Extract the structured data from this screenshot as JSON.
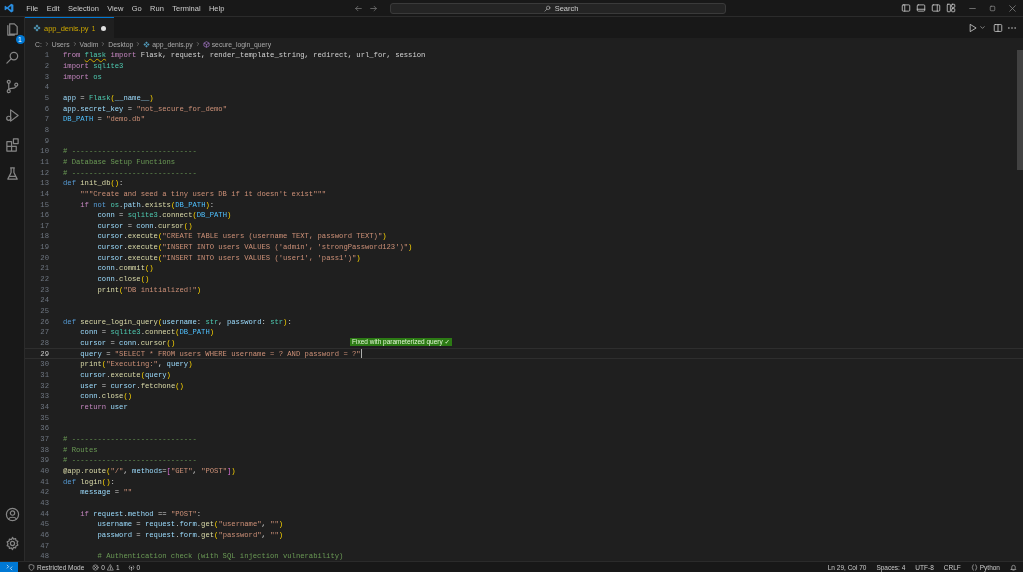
{
  "title_bar": {
    "menus": [
      "File",
      "Edit",
      "Selection",
      "View",
      "Go",
      "Run",
      "Terminal",
      "Help"
    ],
    "search": {
      "placeholder": "Search"
    }
  },
  "activity_bar": {
    "top": [
      {
        "kind": "explorer",
        "badge": "1",
        "selected": false
      },
      {
        "kind": "search",
        "selected": false
      },
      {
        "kind": "source-control",
        "selected": false
      },
      {
        "kind": "run",
        "selected": false
      },
      {
        "kind": "extensions",
        "selected": false
      },
      {
        "kind": "testing",
        "selected": false
      }
    ],
    "bottom": [
      {
        "kind": "account"
      },
      {
        "kind": "settings"
      }
    ]
  },
  "tabs": [
    {
      "label": "app_denis.py",
      "problems": "1",
      "modified": true,
      "selected": true
    }
  ],
  "breadcrumbs": [
    {
      "kind": "folder",
      "text": "C:"
    },
    {
      "kind": "folder",
      "text": "Users"
    },
    {
      "kind": "folder",
      "text": "Vadim"
    },
    {
      "kind": "folder",
      "text": "Desktop"
    },
    {
      "kind": "file",
      "text": "app_denis.py"
    },
    {
      "kind": "symbol",
      "text": "secure_login_query"
    }
  ],
  "editor": {
    "lines": [
      {
        "number": "1",
        "current": false,
        "tokens": [
          {
            "kind": "keyword",
            "text": "from "
          },
          {
            "kind": "module",
            "text": "flask",
            "warning": true
          },
          {
            "kind": "keyword",
            "text": " import"
          },
          {
            "kind": "plain",
            "text": " Flask, request, render_template_string, redirect, url_for, session"
          }
        ]
      },
      {
        "number": "2",
        "current": false,
        "tokens": [
          {
            "kind": "keyword",
            "text": "import"
          },
          {
            "kind": "module",
            "text": " sqlite3"
          }
        ]
      },
      {
        "number": "3",
        "current": false,
        "tokens": [
          {
            "kind": "keyword",
            "text": "import"
          },
          {
            "kind": "module",
            "text": " os"
          }
        ]
      },
      {
        "number": "4",
        "current": false
      },
      {
        "number": "5",
        "current": false,
        "tokens": [
          {
            "kind": "variable",
            "text": "app"
          },
          {
            "kind": "plain",
            "text": " = "
          },
          {
            "kind": "module",
            "text": "Flask"
          },
          {
            "kind": "bracket",
            "text": "("
          },
          {
            "kind": "variable",
            "text": "__name__"
          },
          {
            "kind": "bracket",
            "text": ")"
          }
        ]
      },
      {
        "number": "6",
        "current": false,
        "tokens": [
          {
            "kind": "variable",
            "text": "app"
          },
          {
            "kind": "plain",
            "text": "."
          },
          {
            "kind": "variable",
            "text": "secret_key"
          },
          {
            "kind": "plain",
            "text": " = "
          },
          {
            "kind": "string",
            "text": "\"not_secure_for_demo\""
          }
        ]
      },
      {
        "number": "7",
        "current": false,
        "tokens": [
          {
            "kind": "constant",
            "text": "DB_PATH"
          },
          {
            "kind": "plain",
            "text": " = "
          },
          {
            "kind": "string",
            "text": "\"demo.db\""
          }
        ]
      },
      {
        "number": "8",
        "current": false
      },
      {
        "number": "9",
        "current": false
      },
      {
        "number": "10",
        "current": false,
        "tokens": [
          {
            "kind": "comment",
            "text": "# -----------------------------"
          }
        ]
      },
      {
        "number": "11",
        "current": false,
        "tokens": [
          {
            "kind": "comment",
            "text": "# Database Setup Functions"
          }
        ]
      },
      {
        "number": "12",
        "current": false,
        "tokens": [
          {
            "kind": "comment",
            "text": "# -----------------------------"
          }
        ]
      },
      {
        "number": "13",
        "current": false,
        "tokens": [
          {
            "kind": "storage",
            "text": "def"
          },
          {
            "kind": "function",
            "text": " init_db"
          },
          {
            "kind": "bracket",
            "text": "()"
          },
          {
            "kind": "plain",
            "text": ":"
          }
        ]
      },
      {
        "number": "14",
        "current": false,
        "tokens": [
          {
            "kind": "string",
            "text": "    \"\"\"Create and seed a tiny users DB if it doesn't exist\"\"\""
          }
        ]
      },
      {
        "number": "15",
        "current": false,
        "tokens": [
          {
            "kind": "keyword",
            "text": "    if"
          },
          {
            "kind": "storage",
            "text": " not"
          },
          {
            "kind": "module",
            "text": " os"
          },
          {
            "kind": "plain",
            "text": "."
          },
          {
            "kind": "variable",
            "text": "path"
          },
          {
            "kind": "plain",
            "text": "."
          },
          {
            "kind": "function",
            "text": "exists"
          },
          {
            "kind": "bracket",
            "text": "("
          },
          {
            "kind": "constant",
            "text": "DB_PATH"
          },
          {
            "kind": "bracket",
            "text": ")"
          },
          {
            "kind": "plain",
            "text": ":"
          }
        ]
      },
      {
        "number": "16",
        "current": false,
        "tokens": [
          {
            "kind": "variable",
            "text": "        conn"
          },
          {
            "kind": "plain",
            "text": " = "
          },
          {
            "kind": "module",
            "text": "sqlite3"
          },
          {
            "kind": "plain",
            "text": "."
          },
          {
            "kind": "function",
            "text": "connect"
          },
          {
            "kind": "bracket",
            "text": "("
          },
          {
            "kind": "constant",
            "text": "DB_PATH"
          },
          {
            "kind": "bracket",
            "text": ")"
          }
        ]
      },
      {
        "number": "17",
        "current": false,
        "tokens": [
          {
            "kind": "variable",
            "text": "        cursor"
          },
          {
            "kind": "plain",
            "text": " = "
          },
          {
            "kind": "variable",
            "text": "conn"
          },
          {
            "kind": "plain",
            "text": "."
          },
          {
            "kind": "function",
            "text": "cursor"
          },
          {
            "kind": "bracket",
            "text": "()"
          }
        ]
      },
      {
        "number": "18",
        "current": false,
        "tokens": [
          {
            "kind": "variable",
            "text": "        cursor"
          },
          {
            "kind": "plain",
            "text": "."
          },
          {
            "kind": "function",
            "text": "execute"
          },
          {
            "kind": "bracket",
            "text": "("
          },
          {
            "kind": "string",
            "text": "\"CREATE TABLE users (username TEXT, password TEXT)\""
          },
          {
            "kind": "bracket",
            "text": ")"
          }
        ]
      },
      {
        "number": "19",
        "current": false,
        "tokens": [
          {
            "kind": "variable",
            "text": "        cursor"
          },
          {
            "kind": "plain",
            "text": "."
          },
          {
            "kind": "function",
            "text": "execute"
          },
          {
            "kind": "bracket",
            "text": "("
          },
          {
            "kind": "string",
            "text": "\"INSERT INTO users VALUES ('admin', 'strongPassword123')\""
          },
          {
            "kind": "bracket",
            "text": ")"
          }
        ]
      },
      {
        "number": "20",
        "current": false,
        "tokens": [
          {
            "kind": "variable",
            "text": "        cursor"
          },
          {
            "kind": "plain",
            "text": "."
          },
          {
            "kind": "function",
            "text": "execute"
          },
          {
            "kind": "bracket",
            "text": "("
          },
          {
            "kind": "string",
            "text": "\"INSERT INTO users VALUES ('user1', 'pass1')\""
          },
          {
            "kind": "bracket",
            "text": ")"
          }
        ]
      },
      {
        "number": "21",
        "current": false,
        "tokens": [
          {
            "kind": "variable",
            "text": "        conn"
          },
          {
            "kind": "plain",
            "text": "."
          },
          {
            "kind": "function",
            "text": "commit"
          },
          {
            "kind": "bracket",
            "text": "()"
          }
        ]
      },
      {
        "number": "22",
        "current": false,
        "tokens": [
          {
            "kind": "variable",
            "text": "        conn"
          },
          {
            "kind": "plain",
            "text": "."
          },
          {
            "kind": "function",
            "text": "close"
          },
          {
            "kind": "bracket",
            "text": "()"
          }
        ]
      },
      {
        "number": "23",
        "current": false,
        "tokens": [
          {
            "kind": "function",
            "text": "        print"
          },
          {
            "kind": "bracket",
            "text": "("
          },
          {
            "kind": "string",
            "text": "\"DB initialized!\""
          },
          {
            "kind": "bracket",
            "text": ")"
          }
        ]
      },
      {
        "number": "24",
        "current": false
      },
      {
        "number": "25",
        "current": false
      },
      {
        "number": "26",
        "current": false,
        "tokens": [
          {
            "kind": "storage",
            "text": "def"
          },
          {
            "kind": "function",
            "text": " secure_login_query"
          },
          {
            "kind": "bracket",
            "text": "("
          },
          {
            "kind": "variable",
            "text": "username"
          },
          {
            "kind": "plain",
            "text": ": "
          },
          {
            "kind": "module",
            "text": "str"
          },
          {
            "kind": "plain",
            "text": ", "
          },
          {
            "kind": "variable",
            "text": "password"
          },
          {
            "kind": "plain",
            "text": ": "
          },
          {
            "kind": "module",
            "text": "str"
          },
          {
            "kind": "bracket",
            "text": ")"
          },
          {
            "kind": "plain",
            "text": ":"
          }
        ]
      },
      {
        "number": "27",
        "current": false,
        "tokens": [
          {
            "kind": "variable",
            "text": "    conn"
          },
          {
            "kind": "plain",
            "text": " = "
          },
          {
            "kind": "module",
            "text": "sqlite3"
          },
          {
            "kind": "plain",
            "text": "."
          },
          {
            "kind": "function",
            "text": "connect"
          },
          {
            "kind": "bracket",
            "text": "("
          },
          {
            "kind": "constant",
            "text": "DB_PATH"
          },
          {
            "kind": "bracket",
            "text": ")"
          }
        ]
      },
      {
        "number": "28",
        "current": false,
        "annotation": "Fixed with parameterized query ✓",
        "tokens": [
          {
            "kind": "variable",
            "text": "    cursor"
          },
          {
            "kind": "plain",
            "text": " = "
          },
          {
            "kind": "variable",
            "text": "conn"
          },
          {
            "kind": "plain",
            "text": "."
          },
          {
            "kind": "function",
            "text": "cursor"
          },
          {
            "kind": "bracket",
            "text": "()"
          }
        ]
      },
      {
        "number": "29",
        "current": true,
        "tokens": [
          {
            "kind": "variable",
            "text": "    query"
          },
          {
            "kind": "plain",
            "text": " = "
          },
          {
            "kind": "string",
            "text": "\"SELECT * FROM users WHERE username = ? AND password = ?\""
          }
        ]
      },
      {
        "number": "30",
        "current": false,
        "tokens": [
          {
            "kind": "function",
            "text": "    print"
          },
          {
            "kind": "bracket",
            "text": "("
          },
          {
            "kind": "string",
            "text": "\"Executing:\""
          },
          {
            "kind": "plain",
            "text": ", "
          },
          {
            "kind": "variable",
            "text": "query"
          },
          {
            "kind": "bracket",
            "text": ")"
          }
        ]
      },
      {
        "number": "31",
        "current": false,
        "tokens": [
          {
            "kind": "variable",
            "text": "    cursor"
          },
          {
            "kind": "plain",
            "text": "."
          },
          {
            "kind": "function",
            "text": "execute"
          },
          {
            "kind": "bracket",
            "text": "("
          },
          {
            "kind": "variable",
            "text": "query"
          },
          {
            "kind": "bracket",
            "text": ")"
          }
        ]
      },
      {
        "number": "32",
        "current": false,
        "tokens": [
          {
            "kind": "variable",
            "text": "    user"
          },
          {
            "kind": "plain",
            "text": " = "
          },
          {
            "kind": "variable",
            "text": "cursor"
          },
          {
            "kind": "plain",
            "text": "."
          },
          {
            "kind": "function",
            "text": "fetchone"
          },
          {
            "kind": "bracket",
            "text": "()"
          }
        ]
      },
      {
        "number": "33",
        "current": false,
        "tokens": [
          {
            "kind": "variable",
            "text": "    conn"
          },
          {
            "kind": "plain",
            "text": "."
          },
          {
            "kind": "function",
            "text": "close"
          },
          {
            "kind": "bracket",
            "text": "()"
          }
        ]
      },
      {
        "number": "34",
        "current": false,
        "tokens": [
          {
            "kind": "keyword",
            "text": "    return"
          },
          {
            "kind": "variable",
            "text": " user"
          }
        ]
      },
      {
        "number": "35",
        "current": false
      },
      {
        "number": "36",
        "current": false
      },
      {
        "number": "37",
        "current": false,
        "tokens": [
          {
            "kind": "comment",
            "text": "# -----------------------------"
          }
        ]
      },
      {
        "number": "38",
        "current": false,
        "tokens": [
          {
            "kind": "comment",
            "text": "# Routes"
          }
        ]
      },
      {
        "number": "39",
        "current": false,
        "tokens": [
          {
            "kind": "comment",
            "text": "# -----------------------------"
          }
        ]
      },
      {
        "number": "40",
        "current": false,
        "tokens": [
          {
            "kind": "function",
            "text": "@app.route"
          },
          {
            "kind": "bracket",
            "text": "("
          },
          {
            "kind": "string",
            "text": "\"/\""
          },
          {
            "kind": "plain",
            "text": ", "
          },
          {
            "kind": "variable",
            "text": "methods"
          },
          {
            "kind": "plain",
            "text": "="
          },
          {
            "kind": "bracket2",
            "text": "["
          },
          {
            "kind": "string",
            "text": "\"GET\""
          },
          {
            "kind": "plain",
            "text": ", "
          },
          {
            "kind": "string",
            "text": "\"POST\""
          },
          {
            "kind": "bracket2",
            "text": "]"
          },
          {
            "kind": "bracket",
            "text": ")"
          }
        ]
      },
      {
        "number": "41",
        "current": false,
        "tokens": [
          {
            "kind": "storage",
            "text": "def"
          },
          {
            "kind": "function",
            "text": " login"
          },
          {
            "kind": "bracket",
            "text": "()"
          },
          {
            "kind": "plain",
            "text": ":"
          }
        ]
      },
      {
        "number": "42",
        "current": false,
        "tokens": [
          {
            "kind": "variable",
            "text": "    message"
          },
          {
            "kind": "plain",
            "text": " = "
          },
          {
            "kind": "string",
            "text": "\"\""
          }
        ]
      },
      {
        "number": "43",
        "current": false
      },
      {
        "number": "44",
        "current": false,
        "tokens": [
          {
            "kind": "keyword",
            "text": "    if"
          },
          {
            "kind": "variable",
            "text": " request"
          },
          {
            "kind": "plain",
            "text": "."
          },
          {
            "kind": "variable",
            "text": "method"
          },
          {
            "kind": "plain",
            "text": " == "
          },
          {
            "kind": "string",
            "text": "\"POST\""
          },
          {
            "kind": "plain",
            "text": ":"
          }
        ]
      },
      {
        "number": "45",
        "current": false,
        "tokens": [
          {
            "kind": "variable",
            "text": "        username"
          },
          {
            "kind": "plain",
            "text": " = "
          },
          {
            "kind": "variable",
            "text": "request"
          },
          {
            "kind": "plain",
            "text": "."
          },
          {
            "kind": "variable",
            "text": "form"
          },
          {
            "kind": "plain",
            "text": "."
          },
          {
            "kind": "function",
            "text": "get"
          },
          {
            "kind": "bracket",
            "text": "("
          },
          {
            "kind": "string",
            "text": "\"username\""
          },
          {
            "kind": "plain",
            "text": ", "
          },
          {
            "kind": "string",
            "text": "\"\""
          },
          {
            "kind": "bracket",
            "text": ")"
          }
        ]
      },
      {
        "number": "46",
        "current": false,
        "tokens": [
          {
            "kind": "variable",
            "text": "        password"
          },
          {
            "kind": "plain",
            "text": " = "
          },
          {
            "kind": "variable",
            "text": "request"
          },
          {
            "kind": "plain",
            "text": "."
          },
          {
            "kind": "variable",
            "text": "form"
          },
          {
            "kind": "plain",
            "text": "."
          },
          {
            "kind": "function",
            "text": "get"
          },
          {
            "kind": "bracket",
            "text": "("
          },
          {
            "kind": "string",
            "text": "\"password\""
          },
          {
            "kind": "plain",
            "text": ", "
          },
          {
            "kind": "string",
            "text": "\"\""
          },
          {
            "kind": "bracket",
            "text": ")"
          }
        ]
      },
      {
        "number": "47",
        "current": false
      },
      {
        "number": "48",
        "current": false,
        "tokens": [
          {
            "kind": "comment",
            "text": "        # Authentication check (with SQL injection vulnerability)"
          }
        ]
      }
    ]
  },
  "status_bar": {
    "left": [
      {
        "kind": "remote"
      },
      {
        "kind": "restricted",
        "text": "Restricted Mode"
      },
      {
        "kind": "problems",
        "errors": "0",
        "warnings": "1"
      },
      {
        "kind": "ports",
        "text": "0"
      }
    ],
    "right": [
      {
        "kind": "plain",
        "text": "Ln 29, Col 70"
      },
      {
        "kind": "plain",
        "text": "Spaces: 4"
      },
      {
        "kind": "plain",
        "text": "UTF-8"
      },
      {
        "kind": "plain",
        "text": "CRLF"
      },
      {
        "kind": "language",
        "text": "Python"
      },
      {
        "kind": "bell"
      }
    ]
  }
}
